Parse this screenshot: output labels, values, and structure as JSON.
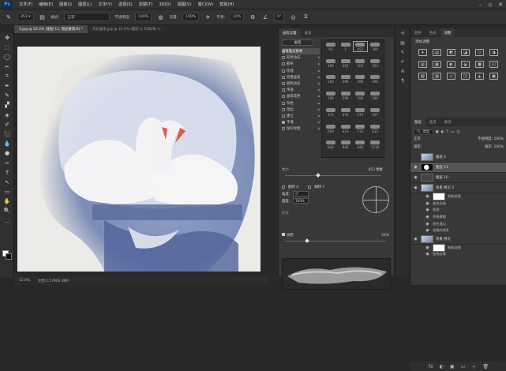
{
  "menu": {
    "items": [
      "文件(F)",
      "编辑(E)",
      "图像(I)",
      "图层(L)",
      "文字(Y)",
      "选择(S)",
      "滤镜(T)",
      "3D(D)",
      "视图(V)",
      "窗口(W)",
      "帮助(H)"
    ],
    "logo": "Ps"
  },
  "options": {
    "size": "453",
    "mode_label": "模式:",
    "mode_value": "正常",
    "opacity_label": "不透明度:",
    "opacity_value": "100%",
    "flow_label": "流量:",
    "flow_value": "100%",
    "smooth_label": "平滑:",
    "smooth_value": "10%",
    "angle_value": "0°"
  },
  "tabs": [
    {
      "label": "4.jpg @ 52.4% (图层 11, 图层蒙版/8) *",
      "active": true
    },
    {
      "label": "水彩画笔.jpg @ 33.5% (图层 0, RGB/8) ×",
      "active": false
    }
  ],
  "status": {
    "zoom": "52.4%",
    "doc": "文档:1.57M/6.38M"
  },
  "brush_settings": {
    "tabs": [
      "画笔设置",
      "画笔"
    ],
    "preset_button": "画笔",
    "items": [
      {
        "label": "画笔笔尖形状",
        "checked": false,
        "selected": true
      },
      {
        "label": "形状动态",
        "checked": false
      },
      {
        "label": "散布",
        "checked": false
      },
      {
        "label": "纹理",
        "checked": false
      },
      {
        "label": "双重画笔",
        "checked": false
      },
      {
        "label": "颜色动态",
        "checked": false
      },
      {
        "label": "传递",
        "checked": false
      },
      {
        "label": "画笔笔势",
        "checked": false
      },
      {
        "label": "杂色",
        "checked": false
      },
      {
        "label": "湿边",
        "checked": false
      },
      {
        "label": "建立",
        "checked": false
      },
      {
        "label": "平滑",
        "checked": true
      },
      {
        "label": "保护纹理",
        "checked": false
      }
    ],
    "tips": [
      "93",
      "1",
      "453",
      "360",
      "490",
      "453",
      "500",
      "353",
      "500",
      "496",
      "496",
      "496",
      "590",
      "590",
      "590",
      "590",
      "470",
      "470",
      "473",
      "507",
      "590",
      "610",
      "715",
      "815",
      "840",
      "840",
      "840",
      "1139"
    ],
    "size_label": "大小",
    "size_value": "453 像素",
    "flip_x": "翻转 X",
    "flip_y": "翻转 Y",
    "angle_label": "角度:",
    "angle_value": "0°",
    "roundness_label": "圆度:",
    "roundness_value": "100%",
    "hardness_label": "硬度",
    "spacing_label": "间距",
    "spacing_value": "25%"
  },
  "adjustments": {
    "tabs": [
      "颜色",
      "色板",
      "调整"
    ],
    "title": "添加调整",
    "icons": [
      "☀",
      "▤",
      "◩",
      "◪",
      "▽",
      "◑",
      "▥",
      "▦",
      "◐",
      "◒",
      "▩",
      "◰",
      "▧",
      "▨",
      "◇",
      "◫",
      "◭",
      "▣"
    ]
  },
  "layers": {
    "tabs": [
      "图层",
      "通道",
      "路径"
    ],
    "kind": "类型",
    "blend": "正常",
    "opacity": "不透明度: 100%",
    "lock": "锁定:",
    "fill": "填充: 100%",
    "rows": [
      {
        "name": "图层 2",
        "thumb": "thumb",
        "eye": "",
        "sel": false,
        "sub": false
      },
      {
        "name": "图层 11",
        "thumb": "mask2",
        "eye": "◉",
        "sel": true,
        "sub": false
      },
      {
        "name": "图层 10",
        "thumb": "gray",
        "eye": "◉",
        "sel": false,
        "sub": false
      },
      {
        "name": "背景 拷贝 2",
        "thumb": "thumb",
        "eye": "◉",
        "sel": false,
        "sub": false
      },
      {
        "name": "智能滤镜",
        "thumb": "mask",
        "eye": "◉",
        "sel": false,
        "sub": true
      },
      {
        "name": "查找边缘",
        "thumb": "",
        "eye": "◉",
        "sel": false,
        "sub": true
      },
      {
        "name": "喷溅",
        "thumb": "",
        "eye": "◉",
        "sel": false,
        "sub": true
      },
      {
        "name": "特殊模糊",
        "thumb": "",
        "eye": "◉",
        "sel": false,
        "sub": true
      },
      {
        "name": "喷色描边",
        "thumb": "",
        "eye": "◉",
        "sel": false,
        "sub": true
      },
      {
        "name": "成角的线条",
        "thumb": "",
        "eye": "◉",
        "sel": false,
        "sub": true
      },
      {
        "name": "背景 拷贝",
        "thumb": "thumb",
        "eye": "◉",
        "sel": false,
        "sub": false
      },
      {
        "name": "智能滤镜",
        "thumb": "mask",
        "eye": "◉",
        "sel": false,
        "sub": true
      },
      {
        "name": "查找边缘",
        "thumb": "",
        "eye": "◉",
        "sel": false,
        "sub": true
      }
    ],
    "footer": [
      "fx",
      "◐",
      "▣",
      "▭",
      "＋",
      "🗑"
    ]
  },
  "tools": [
    "✥",
    "⬚",
    "◯",
    "✂",
    "⌗",
    "✒",
    "✎",
    "▞",
    "◈",
    "✐",
    "⬛",
    "💧",
    "●",
    "✑",
    "T",
    "↖",
    "▭",
    "✋",
    "🔍",
    "…"
  ]
}
